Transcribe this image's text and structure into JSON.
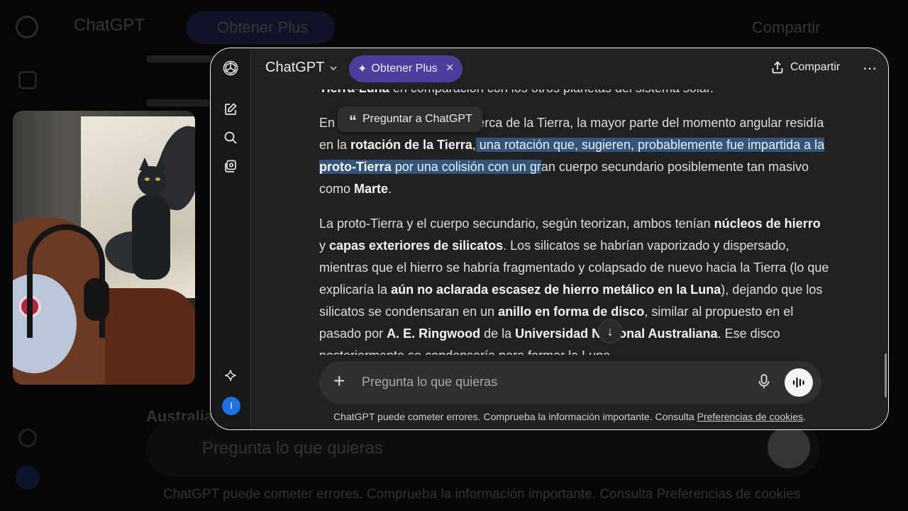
{
  "background": {
    "title": "ChatGPT",
    "plus_label": "Obtener Plus",
    "share_label": "Compartir",
    "section_heading": "Australiana",
    "input_placeholder": "Pregunta lo que quieras",
    "footer_text": "ChatGPT puede cometer errores. Comprueba la información importante. Consulta",
    "footer_link": "Preferencias de cookies"
  },
  "header": {
    "model_name": "ChatGPT",
    "plus_label": "Obtener Plus",
    "share_label": "Compartir"
  },
  "tooltip": {
    "label": "Preguntar a ChatGPT"
  },
  "article": {
    "p0": [
      {
        "t": "Tierra-Luna",
        "b": true
      },
      {
        "t": " en comparación con los otros planetas del sistema solar."
      }
    ],
    "p1": [
      {
        "t": "En "
      },
      {
        "t": "                                cuando la Luna estaba cerca de la Tierra, la mayor parte del momento angular residía en la "
      },
      {
        "t": "rotación de la Tierra",
        "b": true
      },
      {
        "t": ","
      },
      {
        "t": " una rotación que, sugieren, probablemente fue impartida a la ",
        "hl": true
      },
      {
        "t": "proto-Tierra",
        "b": true,
        "hl": true
      },
      {
        "t": " por una colisión con un gr",
        "hl": true
      },
      {
        "t": "an cuerpo secundario posiblemente tan masivo como "
      },
      {
        "t": "Marte",
        "b": true
      },
      {
        "t": "."
      }
    ],
    "p2": [
      {
        "t": "La proto-Tierra y el cuerpo secundario, según teorizan, ambos tenían "
      },
      {
        "t": "núcleos de hierro",
        "b": true
      },
      {
        "t": " y "
      },
      {
        "t": "capas exteriores de silicatos",
        "b": true
      },
      {
        "t": ". Los silicatos se habrían vaporizado y dispersado, mientras que el hierro se habría fragmentado y colapsado de nuevo hacia la Tierra (lo que explicaría la "
      },
      {
        "t": "aún no aclarada escasez de hierro metálico en la Luna",
        "b": true
      },
      {
        "t": "), dejando que los silicatos se condensaran en un "
      },
      {
        "t": "anillo en forma de disco",
        "b": true
      },
      {
        "t": ", similar al propuesto en el pasado por "
      },
      {
        "t": "A. E. Ringwood",
        "b": true
      },
      {
        "t": " de la "
      },
      {
        "t": "Universidad Nacional Australiana",
        "b": true
      },
      {
        "t": ". Ese disco posteriormente se condensaría para formar la Luna."
      }
    ]
  },
  "composer": {
    "placeholder": "Pregunta lo que quieras"
  },
  "footer": {
    "text": "ChatGPT puede cometer errores. Comprueba la información importante. Consulta",
    "link": "Preferencias de cookies",
    "end": "."
  },
  "user": {
    "initial": "I"
  },
  "icons": {
    "logo": "openai-logo-icon",
    "new_chat": "new-chat-icon",
    "search": "search-icon",
    "library": "library-icon",
    "explore": "sparkle-icon",
    "share": "share-icon",
    "more": "more-icon",
    "plus": "plus-icon",
    "mic": "mic-icon",
    "voice": "voice-mode-icon",
    "scroll": "arrow-down-icon"
  },
  "colors": {
    "accent_plus": "#4b3f9b",
    "highlight": "#34557a",
    "avatar": "#1f6fe5"
  }
}
